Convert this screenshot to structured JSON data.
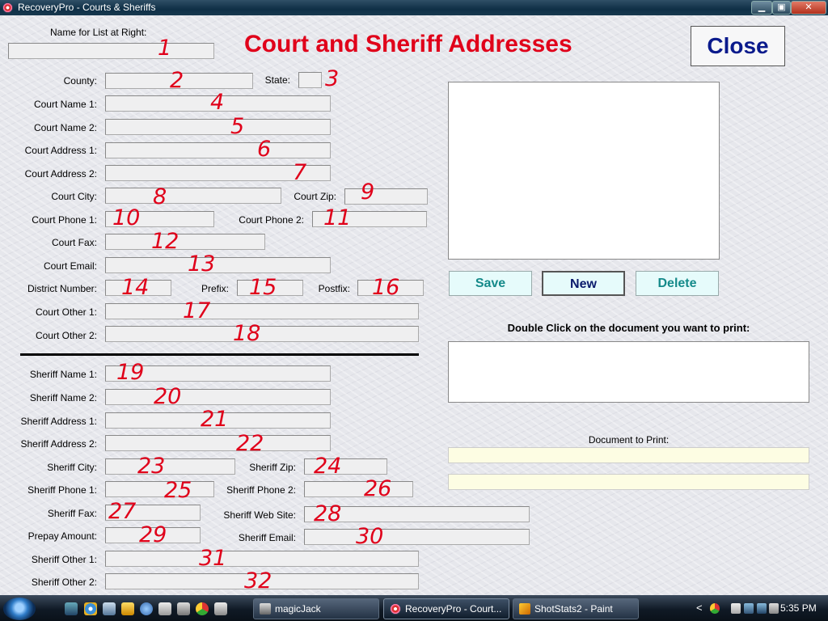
{
  "window": {
    "title": "RecoveryPro - Courts & Sheriffs",
    "min_glyph": "▁",
    "max_glyph": "▣",
    "close_glyph": "✕"
  },
  "heading": "Court and Sheriff Addresses",
  "close_label": "Close",
  "name_for_list_label": "Name for List at Right:",
  "fields": [
    {
      "label": "County:",
      "number": "2"
    },
    {
      "label": "State:",
      "number": "3"
    },
    {
      "label": "Court Name 1:",
      "number": "4"
    },
    {
      "label": "Court Name 2:",
      "number": "5"
    },
    {
      "label": "Court Address 1:",
      "number": "6"
    },
    {
      "label": "Court Address 2:",
      "number": "7"
    },
    {
      "label": "Court City:",
      "number": "8"
    },
    {
      "label": "Court Zip:",
      "number": "9"
    },
    {
      "label": "Court Phone 1:",
      "number": "10"
    },
    {
      "label": "Court Phone 2:",
      "number": "11"
    },
    {
      "label": "Court Fax:",
      "number": "12"
    },
    {
      "label": "Court Email:",
      "number": "13"
    },
    {
      "label": "District Number:",
      "number": "14"
    },
    {
      "label": "Prefix:",
      "number": "15"
    },
    {
      "label": "Postfix:",
      "number": "16"
    },
    {
      "label": "Court Other 1:",
      "number": "17"
    },
    {
      "label": "Court Other 2:",
      "number": "18"
    },
    {
      "label": "Sheriff Name 1:",
      "number": "19"
    },
    {
      "label": "Sheriff Name 2:",
      "number": "20"
    },
    {
      "label": "Sheriff Address 1:",
      "number": "21"
    },
    {
      "label": "Sheriff Address 2:",
      "number": "22"
    },
    {
      "label": "Sheriff City:",
      "number": "23"
    },
    {
      "label": "Sheriff Zip:",
      "number": "24"
    },
    {
      "label": "Sheriff Phone 1:",
      "number": "25"
    },
    {
      "label": "Sheriff Phone 2:",
      "number": "26"
    },
    {
      "label": "Sheriff Fax:",
      "number": "27"
    },
    {
      "label": "Sheriff Web Site:",
      "number": "28"
    },
    {
      "label": "Prepay Amount:",
      "number": "29"
    },
    {
      "label": "Sheriff Email:",
      "number": "30"
    },
    {
      "label": "Sheriff Other 1:",
      "number": "31"
    },
    {
      "label": "Sheriff Other 2:",
      "number": "32"
    }
  ],
  "name_for_list_number": "1",
  "buttons": {
    "save": "Save",
    "new": "New",
    "delete": "Delete"
  },
  "print_instruction": "Double Click on the document you want to print:",
  "document_to_print_label": "Document to Print:",
  "taskbar": {
    "items": [
      {
        "label": "magicJack",
        "active": false
      },
      {
        "label": "RecoveryPro - Court...",
        "active": true
      },
      {
        "label": "ShotStats2 - Paint",
        "active": false
      }
    ],
    "clock": "5:35 PM",
    "tray_chevron": "<"
  },
  "colors": {
    "annotation_red": "#e0001a",
    "close_text": "#0a1a8c",
    "save_text": "#158a8a",
    "new_text": "#0a1a6c",
    "delete_text": "#158a8a",
    "button_fill": "#e6fbfb",
    "yellow_field": "#fdfde3"
  }
}
